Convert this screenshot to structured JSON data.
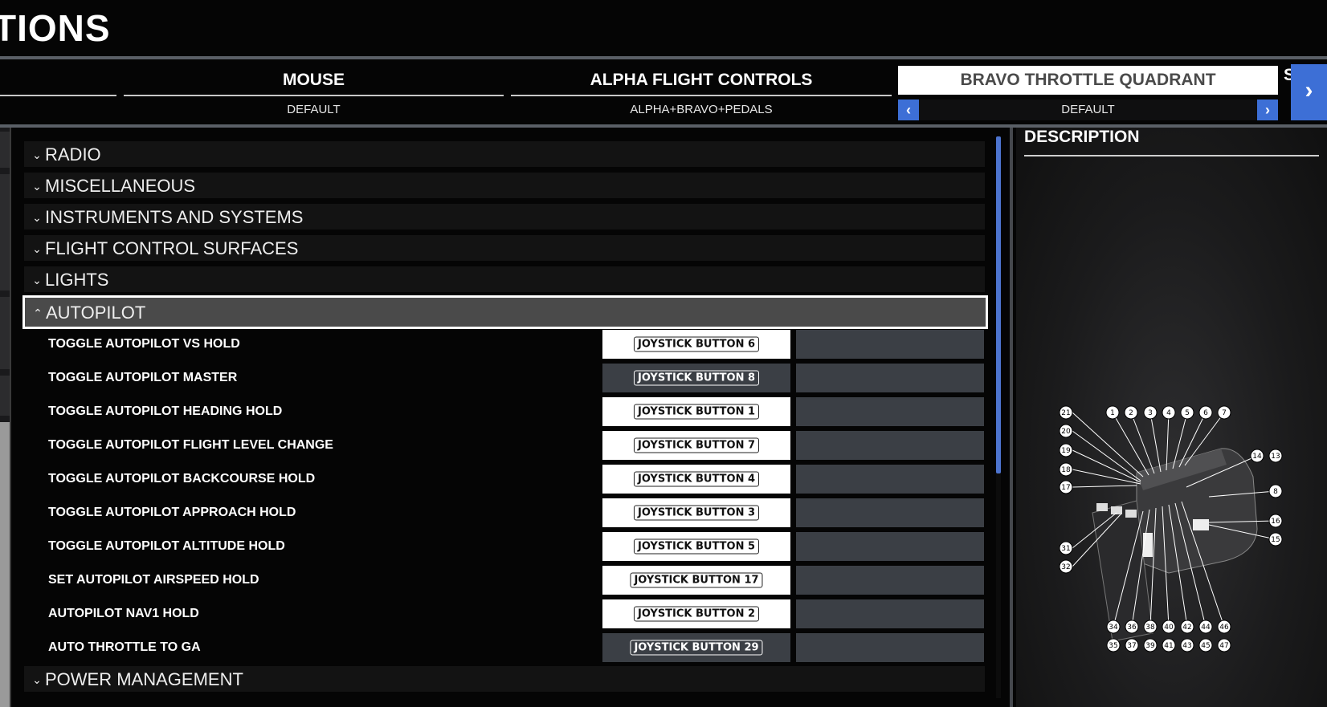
{
  "header": {
    "title": "TIONS"
  },
  "tabs": [
    {
      "name": "MOUSE",
      "profile": "DEFAULT"
    },
    {
      "name": "ALPHA FLIGHT CONTROLS",
      "profile": "ALPHA+BRAVO+PEDALS"
    },
    {
      "name": "BRAVO THROTTLE QUADRANT",
      "profile": "DEFAULT"
    }
  ],
  "tab_partial": "S",
  "categories_top": [
    {
      "label": "RADIO"
    },
    {
      "label": "MISCELLANEOUS"
    },
    {
      "label": "INSTRUMENTS AND SYSTEMS"
    },
    {
      "label": "FLIGHT CONTROL SURFACES"
    },
    {
      "label": "LIGHTS"
    }
  ],
  "selected_category": {
    "label": "AUTOPILOT"
  },
  "bindings": [
    {
      "action": "TOGGLE AUTOPILOT VS HOLD",
      "input": "JOYSTICK BUTTON 6"
    },
    {
      "action": "TOGGLE AUTOPILOT MASTER",
      "input": "JOYSTICK BUTTON 8"
    },
    {
      "action": "TOGGLE AUTOPILOT HEADING HOLD",
      "input": "JOYSTICK BUTTON 1"
    },
    {
      "action": "TOGGLE AUTOPILOT FLIGHT LEVEL CHANGE",
      "input": "JOYSTICK BUTTON 7"
    },
    {
      "action": "TOGGLE AUTOPILOT BACKCOURSE HOLD",
      "input": "JOYSTICK BUTTON 4"
    },
    {
      "action": "TOGGLE AUTOPILOT APPROACH HOLD",
      "input": "JOYSTICK BUTTON 3"
    },
    {
      "action": "TOGGLE AUTOPILOT ALTITUDE HOLD",
      "input": "JOYSTICK BUTTON 5"
    },
    {
      "action": "SET AUTOPILOT AIRSPEED HOLD",
      "input": "JOYSTICK BUTTON 17"
    },
    {
      "action": "AUTOPILOT NAV1 HOLD",
      "input": "JOYSTICK BUTTON 2"
    },
    {
      "action": "AUTO THROTTLE TO GA",
      "input": "JOYSTICK BUTTON 29"
    }
  ],
  "category_bottom": {
    "label": "POWER MANAGEMENT"
  },
  "description": {
    "title": "DESCRIPTION",
    "callouts": [
      "21",
      "1",
      "2",
      "3",
      "4",
      "5",
      "6",
      "7",
      "20",
      "19",
      "18",
      "17",
      "14",
      "13",
      "8",
      "16",
      "15",
      "31",
      "32",
      "34",
      "36",
      "38",
      "40",
      "42",
      "44",
      "46",
      "35",
      "37",
      "39",
      "41",
      "43",
      "45",
      "47"
    ]
  }
}
